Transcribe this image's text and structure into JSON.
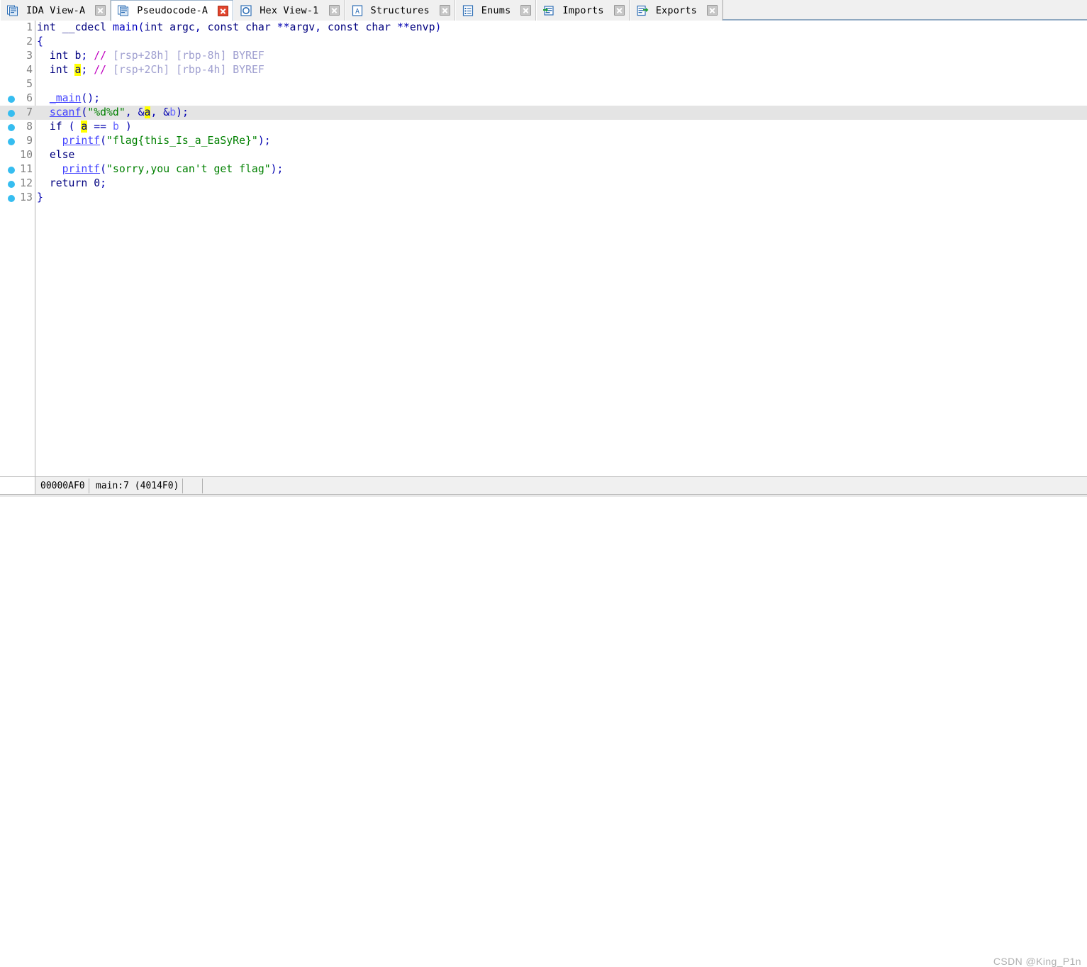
{
  "window": {
    "title": "IDA Pseudocode View"
  },
  "tabs": [
    {
      "label": "IDA View-A",
      "icon": "document-window-icon",
      "active": false,
      "close_icon": "close-icon"
    },
    {
      "label": "Pseudocode-A",
      "icon": "document-window-icon",
      "active": true,
      "close_icon": "close-icon"
    },
    {
      "label": "Hex View-1",
      "icon": "hex-view-icon",
      "active": false,
      "close_icon": "close-icon"
    },
    {
      "label": "Structures",
      "icon": "structures-icon",
      "active": false,
      "close_icon": "close-icon"
    },
    {
      "label": "Enums",
      "icon": "enums-icon",
      "active": false,
      "close_icon": "close-icon"
    },
    {
      "label": "Imports",
      "icon": "imports-icon",
      "active": false,
      "close_icon": "close-icon"
    },
    {
      "label": "Exports",
      "icon": "exports-icon",
      "active": false,
      "close_icon": "close-icon"
    }
  ],
  "code": {
    "highlighted_line": 7,
    "breakpoint_lines": [
      6,
      7,
      8,
      9,
      11,
      12,
      13
    ],
    "highlighted_identifier": "a",
    "lines": [
      {
        "n": 1,
        "text": "int __cdecl main(int argc, const char **argv, const char **envp)"
      },
      {
        "n": 2,
        "text": "{"
      },
      {
        "n": 3,
        "text": "  int b; // [rsp+28h] [rbp-8h] BYREF"
      },
      {
        "n": 4,
        "text": "  int a; // [rsp+2Ch] [rbp-4h] BYREF"
      },
      {
        "n": 5,
        "text": ""
      },
      {
        "n": 6,
        "text": "  _main();"
      },
      {
        "n": 7,
        "text": "  scanf(\"%d%d\", &a, &b);"
      },
      {
        "n": 8,
        "text": "  if ( a == b )"
      },
      {
        "n": 9,
        "text": "    printf(\"flag{this_Is_a_EaSyRe}\");"
      },
      {
        "n": 10,
        "text": "  else"
      },
      {
        "n": 11,
        "text": "    printf(\"sorry,you can't get flag\");"
      },
      {
        "n": 12,
        "text": "  return 0;"
      },
      {
        "n": 13,
        "text": "}"
      }
    ],
    "strings": {
      "scanf_format": "%d%d",
      "flag_string": "flag{this_Is_a_EaSyRe}",
      "fail_string": "sorry,you can't get flag"
    },
    "variables": [
      "a",
      "b"
    ],
    "comments": {
      "line3": "// [rsp+28h] [rbp-8h] BYREF",
      "line4": "// [rsp+2Ch] [rbp-4h] BYREF"
    }
  },
  "statusbar": {
    "address": "00000AF0",
    "function": "main:7  (4014F0)",
    "watermark": "CSDN @King_P1n"
  },
  "colors": {
    "keyword": "#00007f",
    "library_call": "#4444ff",
    "string": "#008000",
    "comment": "#a0a0d0",
    "comment_slash": "#c000c0",
    "highlight_var_bg": "#ffff00",
    "current_line_bg": "#e4e4e4",
    "breakpoint_dot": "#36bdf0",
    "active_tab_close": "#e2452e"
  }
}
